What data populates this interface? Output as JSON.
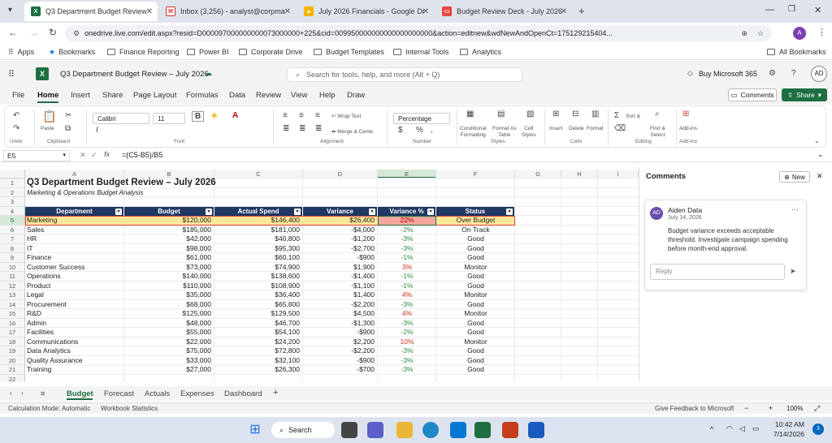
{
  "browser_tabs": [
    {
      "title": "Q3 Department Budget Review",
      "icon": "excel-icon",
      "color": "#1d6f42",
      "active": true
    },
    {
      "title": "Inbox (3,256) - analyst@corpma",
      "icon": "gmail-icon",
      "color": "#d93025"
    },
    {
      "title": "July 2026 Financials - Google Dr",
      "icon": "drive-icon",
      "color": "#f4b400"
    },
    {
      "title": "Budget Review Deck - July 2026",
      "icon": "slides-icon",
      "color": "#e8453c"
    }
  ],
  "url": "onedrive.live.com/edit.aspx?resid=D000097000000000073000000+225&cid=009950000000000000000000&action=editnew&wdNewAndOpenCt=175129215404...",
  "bookmarks": {
    "apps": "Apps",
    "items": [
      "Bookmarks",
      "Finance Reporting",
      "Power BI",
      "Corporate Drive",
      "Budget Templates",
      "Internal Tools",
      "Analytics"
    ],
    "all": "All Bookmarks"
  },
  "excel": {
    "doc_title": "Q3 Department Budget Review – July 2026",
    "search_placeholder": "Search for tools, help, and more (Alt + Q)",
    "buy": "Buy Microsoft 365",
    "avatar": "AD",
    "menu": [
      "File",
      "Home",
      "Insert",
      "Share",
      "Page Layout",
      "Formulas",
      "Data",
      "Review",
      "View",
      "Help",
      "Draw"
    ],
    "comments_btn": "Comments",
    "share_btn": "Share"
  },
  "ribbon": {
    "undo_group": "Undo",
    "paste": "Paste",
    "clipboard_group": "Clipboard",
    "font_name": "Calibri",
    "font_size": "11",
    "font_group": "Font",
    "wrap_text": "Wrap Text",
    "merge": "Merge & Cente",
    "alignment_group": "Alignment",
    "number_format": "Percentage",
    "number_group": "Number",
    "cond_format": [
      "Conditional",
      "Formatting"
    ],
    "format_table": [
      "Format As",
      "Table"
    ],
    "cell_styles": [
      "Cell",
      "Styles"
    ],
    "styles_group": "Styles",
    "insert": "Insert",
    "delete": "Delete",
    "format": "Format",
    "cells_group": "Cells",
    "sort": "Sort &",
    "find": [
      "Find &",
      "Select"
    ],
    "editing_group": "Editing",
    "addins": "Add-ins",
    "addins_group": "Add-ins"
  },
  "formula_bar": {
    "name_box": "E5",
    "formula": "=(C5-B5)/B5"
  },
  "columns": [
    "A",
    "B",
    "C",
    "D",
    "E",
    "F",
    "G",
    "H",
    "I"
  ],
  "sheet": {
    "title": "Q3 Department Budget Review – July 2026",
    "subtitle": "Marketing & Operations Budget Analysis",
    "headers": [
      "Department",
      "Budget",
      "Actual Spend",
      "Variance",
      "Variance %",
      "Status"
    ],
    "rows": [
      [
        "Marketing",
        "$120,000",
        "$146,400",
        "$26,400",
        "22%",
        "Over Budget"
      ],
      [
        "Sales",
        "$185,000",
        "$181,000",
        "-$4,000",
        "-2%",
        "On Track"
      ],
      [
        "HR",
        "$42,000",
        "$40,800",
        "-$1,200",
        "-3%",
        "Good"
      ],
      [
        "IT",
        "$98,000",
        "$95,300",
        "-$2,700",
        "-3%",
        "Good"
      ],
      [
        "Finance",
        "$61,000",
        "$60,100",
        "-$900",
        "-1%",
        "Good"
      ],
      [
        "Customer Success",
        "$73,000",
        "$74,900",
        "$1,900",
        "3%",
        "Monitor"
      ],
      [
        "Operations",
        "$140,000",
        "$138,600",
        "-$1,400",
        "-1%",
        "Good"
      ],
      [
        "Product",
        "$110,000",
        "$108,900",
        "-$1,100",
        "-1%",
        "Good"
      ],
      [
        "Legal",
        "$35,000",
        "$36,400",
        "$1,400",
        "4%",
        "Monitor"
      ],
      [
        "Procurement",
        "$68,000",
        "$65,800",
        "-$2,200",
        "-3%",
        "Good"
      ],
      [
        "R&D",
        "$125,000",
        "$129,500",
        "$4,500",
        "4%",
        "Monitor"
      ],
      [
        "Admin",
        "$48,000",
        "$46,700",
        "-$1,300",
        "-3%",
        "Good"
      ],
      [
        "Facilities",
        "$55,000",
        "$54,100",
        "-$900",
        "-2%",
        "Good"
      ],
      [
        "Communications",
        "$22,000",
        "$24,200",
        "$2,200",
        "10%",
        "Monitor"
      ],
      [
        "Data Analytics",
        "$75,000",
        "$72,800",
        "-$2,200",
        "-3%",
        "Good"
      ],
      [
        "Quality Assurance",
        "$33,000",
        "$32,100",
        "-$900",
        "-3%",
        "Good"
      ],
      [
        "Training",
        "$27,000",
        "$26,300",
        "-$700",
        "-3%",
        "Good"
      ]
    ]
  },
  "comments": {
    "title": "Comments",
    "new_btn": "New",
    "author": "Aiden Data",
    "initials": "AD",
    "date": "July 14, 2026",
    "text": "Budget variance exceeds acceptable threshold. Investigate campaign spending before month-end approval.",
    "reply_placeholder": "Reply"
  },
  "sheet_tabs": [
    "Budget",
    "Forecast",
    "Actuals",
    "Expenses",
    "Dashboard"
  ],
  "status": {
    "calc": "Calculation Mode: Automatic",
    "stats": "Workbook Statistics",
    "feedback": "Give Feedback to Microsoft",
    "zoom": "100%"
  },
  "taskbar": {
    "search": "Search",
    "time": "10:42 AM",
    "date": "7/14/2026",
    "badge": "3"
  }
}
